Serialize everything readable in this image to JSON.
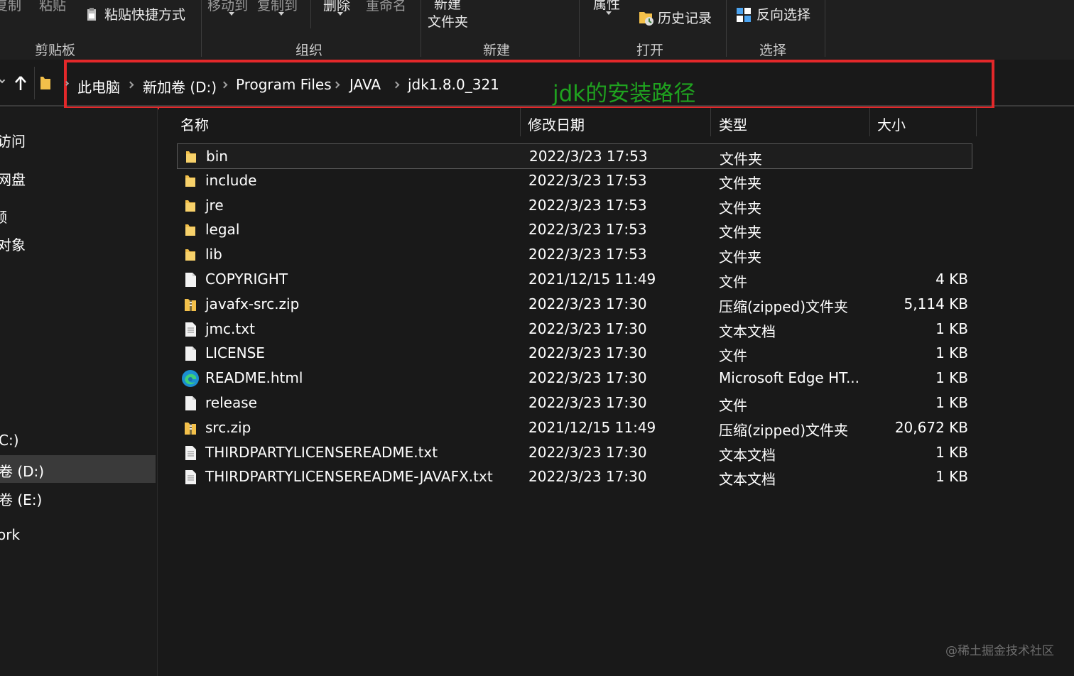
{
  "ribbon": {
    "copy_path": "复制",
    "paste": "粘贴",
    "paste_shortcut": "粘贴快捷方式",
    "move_to": "移动到",
    "copy_to": "复制到",
    "delete": "删除",
    "rename": "重命名",
    "new_folder_line1": "新建",
    "new_folder_line2": "文件夹",
    "properties": "属性",
    "history": "历史记录",
    "invert_select": "反向选择",
    "group_clipboard": "剪贴板",
    "group_organize": "组织",
    "group_new": "新建",
    "group_open": "打开",
    "group_select": "选择"
  },
  "address": {
    "crumbs": [
      "此电脑",
      "新加卷 (D:)",
      "Program Files",
      "JAVA",
      "jdk1.8.0_321"
    ],
    "annotation": "jdk的安装路径",
    "annotation_color": "#1fa11f",
    "highlight_color": "#e3282a"
  },
  "nav": {
    "items": [
      "访问",
      "网盘",
      "频",
      "对象",
      "C:)",
      "卷 (D:)",
      "卷 (E:)",
      "ork"
    ]
  },
  "columns": {
    "name": "名称",
    "date": "修改日期",
    "type": "类型",
    "size": "大小"
  },
  "files": [
    {
      "name": "bin",
      "date": "2022/3/23 17:53",
      "type": "文件夹",
      "size": "",
      "icon": "folder-icon"
    },
    {
      "name": "include",
      "date": "2022/3/23 17:53",
      "type": "文件夹",
      "size": "",
      "icon": "folder-icon"
    },
    {
      "name": "jre",
      "date": "2022/3/23 17:53",
      "type": "文件夹",
      "size": "",
      "icon": "folder-icon"
    },
    {
      "name": "legal",
      "date": "2022/3/23 17:53",
      "type": "文件夹",
      "size": "",
      "icon": "folder-icon"
    },
    {
      "name": "lib",
      "date": "2022/3/23 17:53",
      "type": "文件夹",
      "size": "",
      "icon": "folder-icon"
    },
    {
      "name": "COPYRIGHT",
      "date": "2021/12/15 11:49",
      "type": "文件",
      "size": "4 KB",
      "icon": "file-icon"
    },
    {
      "name": "javafx-src.zip",
      "date": "2022/3/23 17:30",
      "type": "压缩(zipped)文件夹",
      "size": "5,114 KB",
      "icon": "zip-icon"
    },
    {
      "name": "jmc.txt",
      "date": "2022/3/23 17:30",
      "type": "文本文档",
      "size": "1 KB",
      "icon": "text-file-icon"
    },
    {
      "name": "LICENSE",
      "date": "2022/3/23 17:30",
      "type": "文件",
      "size": "1 KB",
      "icon": "file-icon"
    },
    {
      "name": "README.html",
      "date": "2022/3/23 17:30",
      "type": "Microsoft Edge HT...",
      "size": "1 KB",
      "icon": "edge-icon"
    },
    {
      "name": "release",
      "date": "2022/3/23 17:30",
      "type": "文件",
      "size": "1 KB",
      "icon": "file-icon"
    },
    {
      "name": "src.zip",
      "date": "2021/12/15 11:49",
      "type": "压缩(zipped)文件夹",
      "size": "20,672 KB",
      "icon": "zip-icon"
    },
    {
      "name": "THIRDPARTYLICENSEREADME.txt",
      "date": "2022/3/23 17:30",
      "type": "文本文档",
      "size": "1 KB",
      "icon": "text-file-icon"
    },
    {
      "name": "THIRDPARTYLICENSEREADME-JAVAFX.txt",
      "date": "2022/3/23 17:30",
      "type": "文本文档",
      "size": "1 KB",
      "icon": "text-file-icon"
    }
  ],
  "watermark": "@稀土掘金技术社区"
}
